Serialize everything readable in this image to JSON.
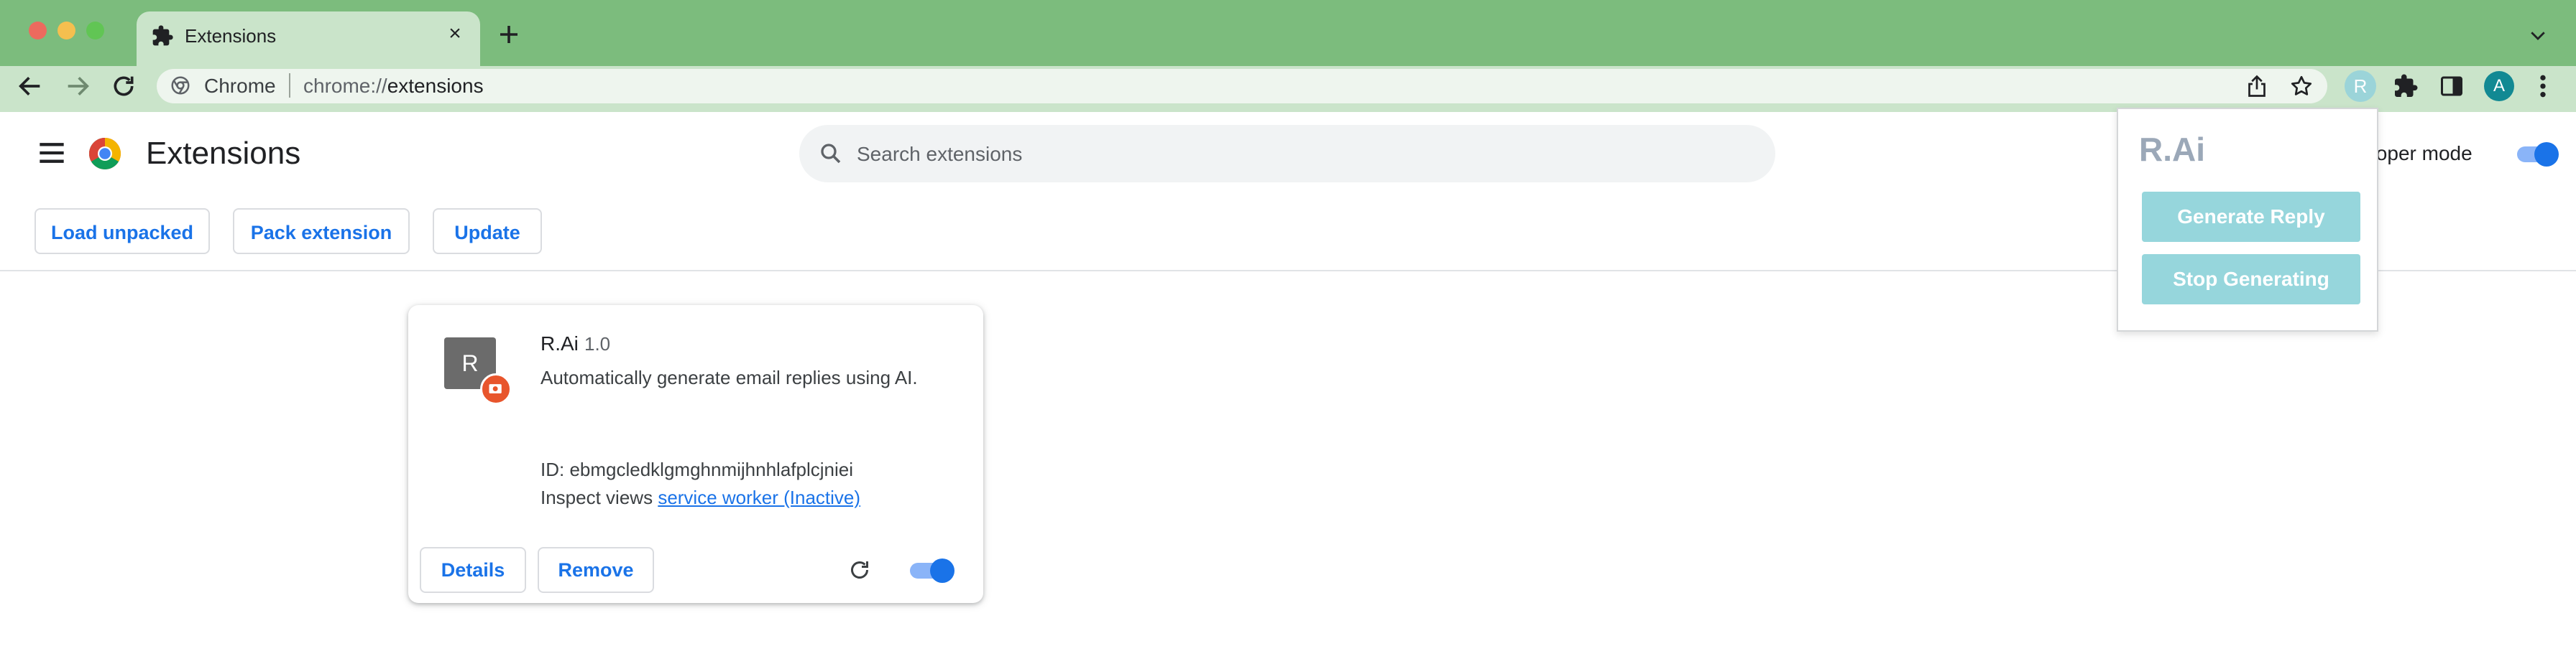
{
  "window": {
    "tab_title": "Extensions",
    "tab_close": "×"
  },
  "toolbar": {
    "omnibox_site": "Chrome",
    "omnibox_url_prefix": "chrome://",
    "omnibox_url_path": "extensions",
    "extension_button_letter": "R",
    "profile_letter": "A"
  },
  "page": {
    "title": "Extensions",
    "search_placeholder": "Search extensions",
    "developer_mode_label": "veloper mode",
    "developer_mode_on": true,
    "buttons": {
      "load_unpacked": "Load unpacked",
      "pack_extension": "Pack extension",
      "update": "Update"
    }
  },
  "extension_card": {
    "icon_letter": "R",
    "name": "R.Ai",
    "version": "1.0",
    "description": "Automatically generate email replies using AI.",
    "id_text": "ID: ebmgcledklgmghnmijhnhlafplcjniei",
    "inspect_label": "Inspect views",
    "inspect_link": "service worker (Inactive)",
    "details_label": "Details",
    "remove_label": "Remove",
    "enabled": true
  },
  "popup": {
    "title": "R.Ai",
    "generate_label": "Generate Reply",
    "stop_label": "Stop Generating"
  },
  "colors": {
    "frame": "#7cbc7d",
    "toolbar": "#cae4ca",
    "accent": "#1a73e8",
    "popup_button": "#96d6dc"
  }
}
